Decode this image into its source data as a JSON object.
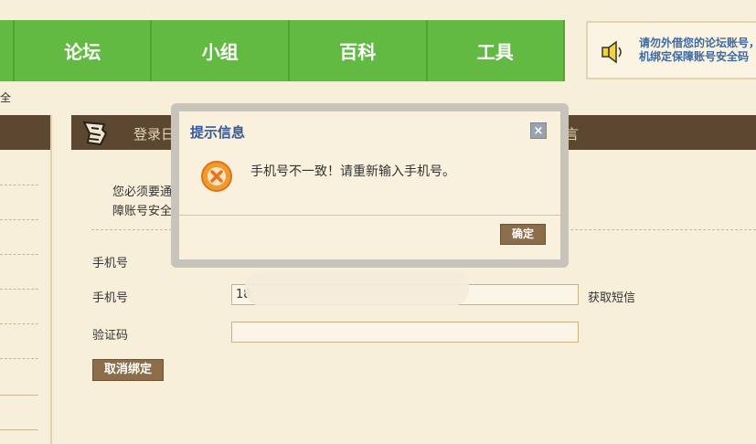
{
  "nav": {
    "items": [
      "",
      "论坛",
      "小组",
      "百科",
      "工具"
    ]
  },
  "notice": {
    "text": "请勿外借您的论坛账号，设置手机绑定保障账号安全码"
  },
  "breadcrumb": "全",
  "main": {
    "header_title": "登录日",
    "header_tail": "言",
    "description_line1": "您必须要通过手机绑定验证平台，否则将导致账号无法继续正常",
    "description_line2": "障账号安全。"
  },
  "form": {
    "phone_label_1": "手机号",
    "phone_label_2": "手机号",
    "phone_value": "18",
    "sms_link": "获取短信",
    "code_label": "验证码",
    "code_value": "",
    "unbind_button": "取消绑定"
  },
  "dialog": {
    "title": "提示信息",
    "close": "×",
    "message": "手机号不一致！请重新输入手机号。",
    "ok_button": "确定"
  },
  "colors": {
    "nav_green": "#62ba42",
    "header_brown": "#5c4830",
    "button_brown": "#8b6d49",
    "title_blue": "#355a95"
  }
}
